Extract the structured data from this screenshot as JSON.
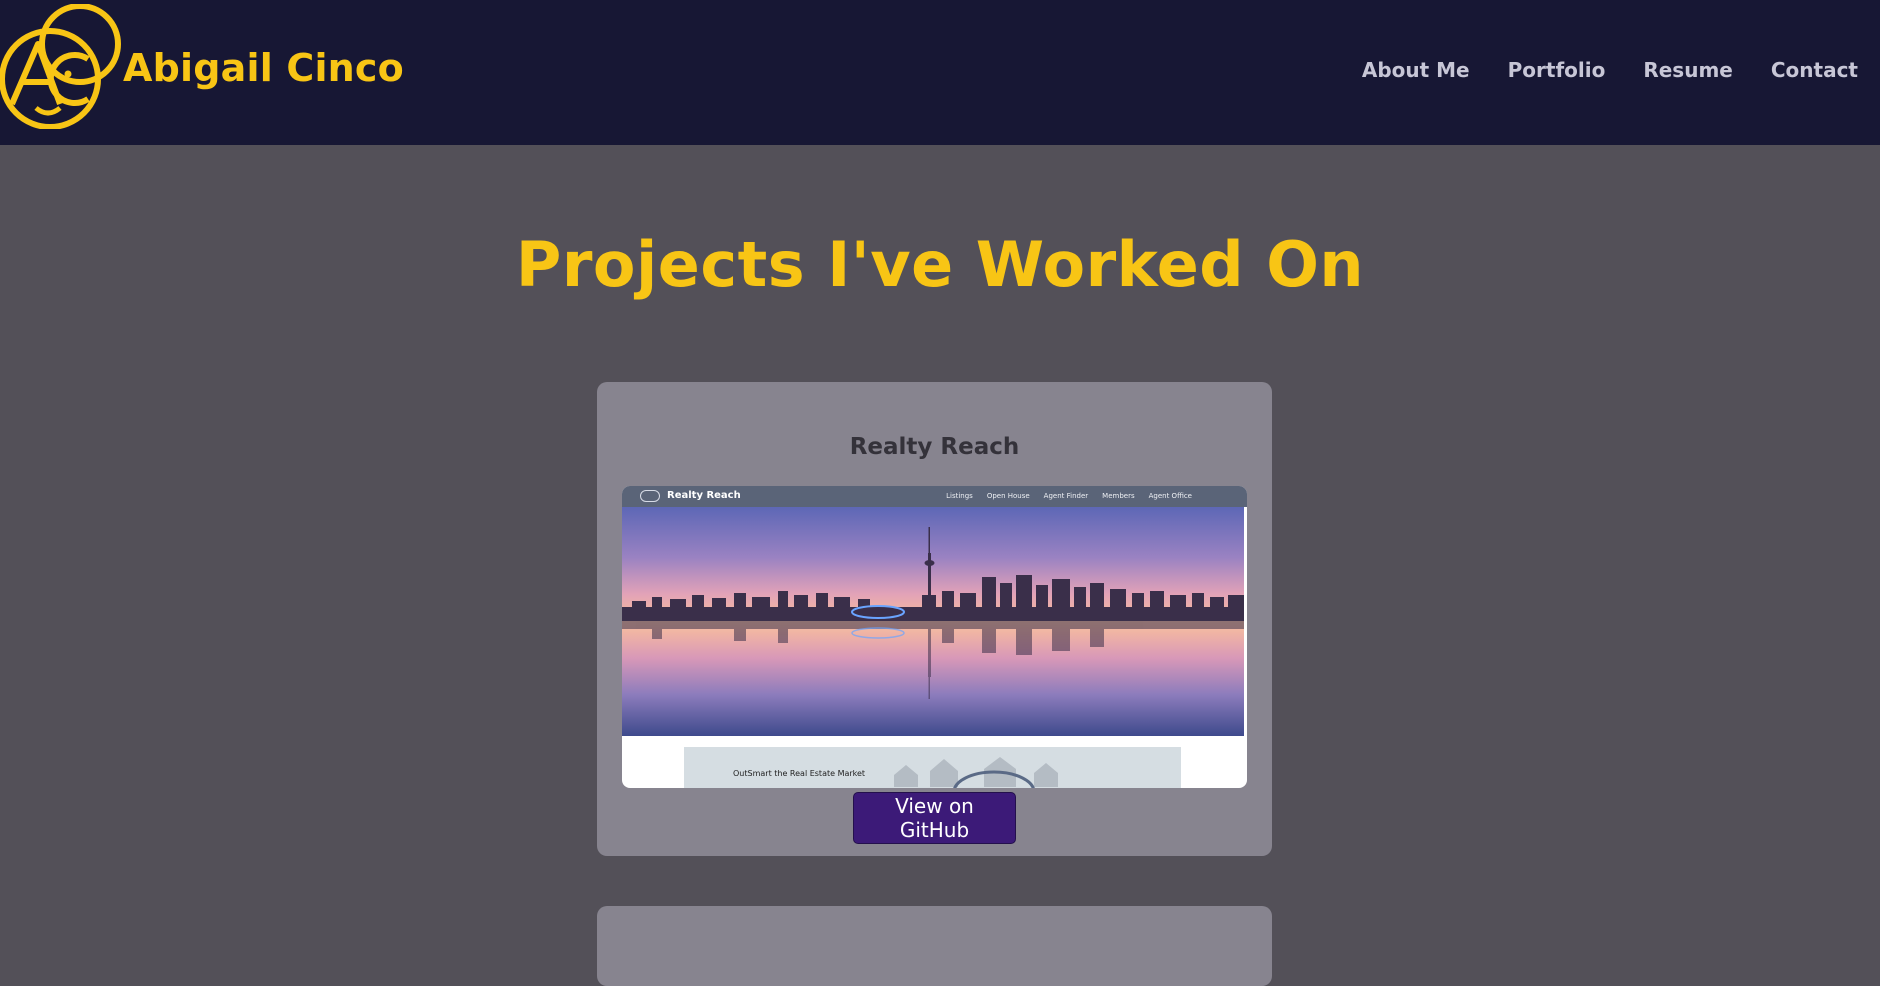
{
  "header": {
    "brand_name": "Abigail Cinco",
    "logo_initials": "AC",
    "nav": [
      {
        "label": "About Me"
      },
      {
        "label": "Portfolio"
      },
      {
        "label": "Resume"
      },
      {
        "label": "Contact"
      }
    ]
  },
  "main": {
    "heading": "Projects I've Worked On",
    "projects": [
      {
        "title": "Realty Reach",
        "button_label": "View on GitHub",
        "screenshot": {
          "brand": "Realty Reach",
          "nav": [
            "Listings",
            "Open House",
            "Agent Finder",
            "Members",
            "Agent Office"
          ],
          "banner_text": "OutSmart the Real Estate Market"
        }
      }
    ]
  },
  "colors": {
    "header_bg": "#171734",
    "page_bg": "#535058",
    "accent_yellow": "#f8c515",
    "card_bg": "#87848f",
    "button_bg": "#3c1a78"
  }
}
